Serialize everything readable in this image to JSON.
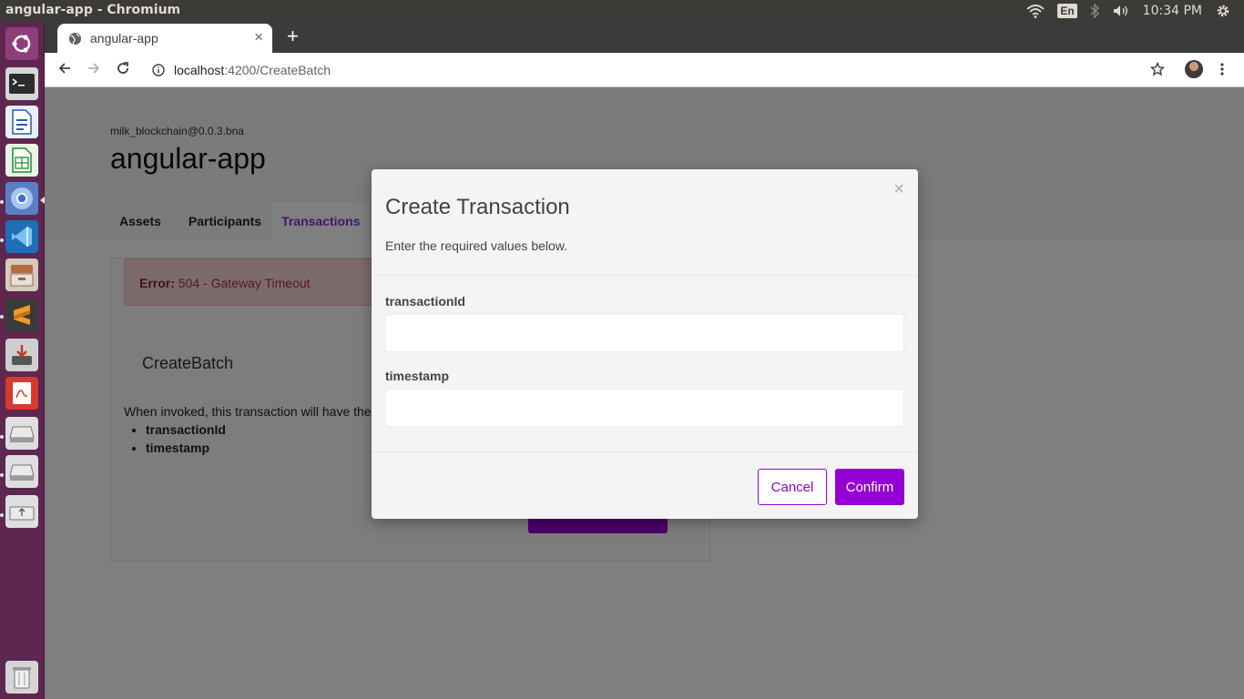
{
  "os": {
    "window_title": "angular-app - Chromium",
    "keyboard_layout": "En",
    "clock": "10:34 PM"
  },
  "launcher": {
    "items": [
      "ubuntu-dash-icon",
      "terminal-icon",
      "libreoffice-writer-icon",
      "libreoffice-calc-icon",
      "chromium-icon",
      "vscode-icon",
      "file-archive-icon",
      "sublime-text-icon",
      "installer-icon",
      "evince-pdf-icon",
      "disk-drive-icon",
      "disk-drive-icon",
      "usb-drive-icon",
      "trash-icon"
    ]
  },
  "browser": {
    "tab_title": "angular-app",
    "url_host": "localhost",
    "url_path": ":4200/CreateBatch"
  },
  "page": {
    "package": "milk_blockchain@0.0.3.bna",
    "title": "angular-app",
    "nav_tabs": [
      "Assets",
      "Participants",
      "Transactions"
    ],
    "active_tab": "Transactions",
    "error_label": "Error:",
    "error_text": "504 - Gateway Timeout",
    "transaction_name": "CreateBatch",
    "description": "When invoked, this transaction will have the",
    "params": [
      "transactionId",
      "timestamp"
    ]
  },
  "modal": {
    "close": "×",
    "title": "Create Transaction",
    "subtitle": "Enter the required values below.",
    "fields": [
      {
        "label": "transactionId",
        "value": ""
      },
      {
        "label": "timestamp",
        "value": ""
      }
    ],
    "cancel": "Cancel",
    "confirm": "Confirm"
  },
  "colors": {
    "accent": "#9400d3",
    "launcher_bg": "#5e2750",
    "topbar_bg": "#3c3b37",
    "error_bg": "#f8d7da"
  }
}
